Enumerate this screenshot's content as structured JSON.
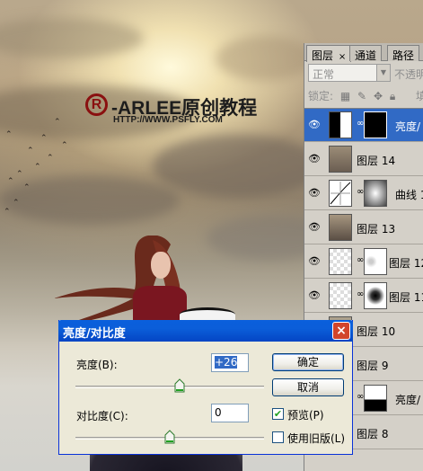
{
  "watermark": {
    "logo_glyph": "R",
    "title": "-ARLEE原创教程",
    "url": "HTTP://WWW.PSFLY.COM"
  },
  "layers_panel": {
    "tabs": [
      {
        "label": "图层",
        "close": "×",
        "active": true
      },
      {
        "label": "通道",
        "active": false
      },
      {
        "label": "路径",
        "active": false
      }
    ],
    "blend_mode": "正常",
    "opacity_label": "不透明",
    "lock_label": "锁定:",
    "fill_label": "填",
    "layers": [
      {
        "name": "亮度/",
        "selected": true,
        "thumb": "adjustment",
        "has_mask": true
      },
      {
        "name": "图层 14",
        "selected": false,
        "thumb": "photo"
      },
      {
        "name": "曲线 1",
        "selected": false,
        "thumb": "curves",
        "has_mask": true
      },
      {
        "name": "图层 13",
        "selected": false,
        "thumb": "photo"
      },
      {
        "name": "图层 12",
        "selected": false,
        "thumb": "transparent",
        "has_mask": true
      },
      {
        "name": "图层 11",
        "selected": false,
        "thumb": "transparent",
        "has_mask": true
      },
      {
        "name": "图层 10",
        "selected": false,
        "thumb": "photo"
      },
      {
        "name": "图层 9",
        "selected": false,
        "thumb": "photo"
      },
      {
        "name": "亮度/",
        "selected": false,
        "thumb": "adjustment",
        "has_mask": true
      },
      {
        "name": "图层 8",
        "selected": false,
        "thumb": "photo"
      }
    ]
  },
  "dialog": {
    "title": "亮度/对比度",
    "close_glyph": "×",
    "brightness_label": "亮度(B):",
    "brightness_value": "+26",
    "brightness_level": 0.55,
    "contrast_label": "对比度(C):",
    "contrast_value": "0",
    "contrast_level": 0.5,
    "ok_label": "确定",
    "cancel_label": "取消",
    "preview_label": "预览(P)",
    "preview_checked": true,
    "legacy_label": "使用旧版(L)",
    "legacy_checked": false
  }
}
